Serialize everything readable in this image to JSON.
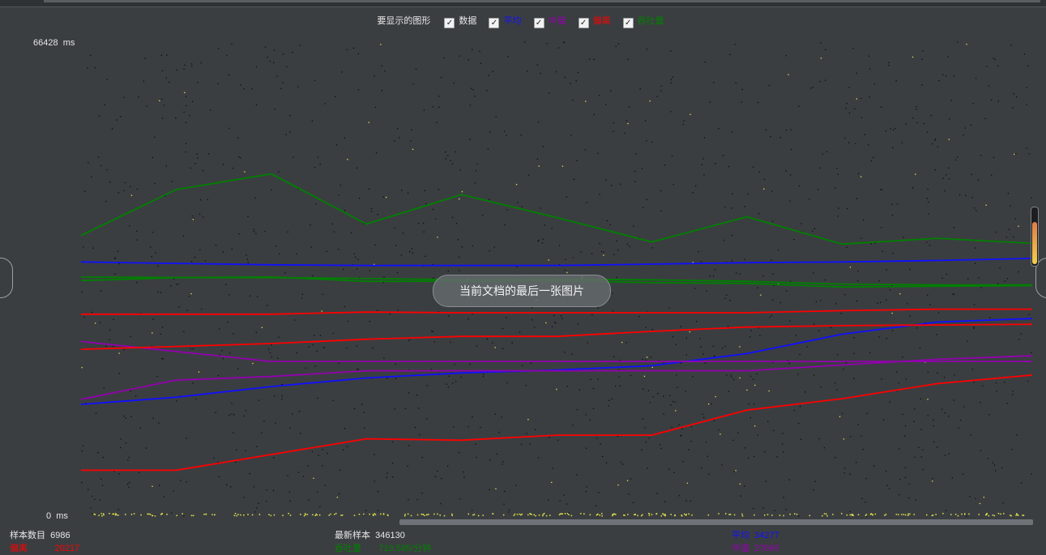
{
  "legend": {
    "title": "要显示的图形",
    "items": [
      {
        "label": "数据",
        "color": "#e6e6e6",
        "checked": true
      },
      {
        "label": "平均",
        "color": "#1010ff",
        "checked": true
      },
      {
        "label": "中值",
        "color": "#9400b0",
        "checked": true
      },
      {
        "label": "偏离",
        "color": "#ff0000",
        "checked": true
      },
      {
        "label": "吞吐量",
        "color": "#008000",
        "checked": true
      }
    ]
  },
  "axis": {
    "y_max_value": "66428",
    "y_min_value": "0",
    "unit": "ms"
  },
  "toast": "当前文档的最后一张图片",
  "stats": {
    "samples_label": "样本数目",
    "samples_value": "6986",
    "deviation_label": "偏离",
    "deviation_value": "20217",
    "latest_label": "最新样本",
    "latest_value": "346130",
    "throughput_label": "吞吐量",
    "throughput_value": "719,585/分钟",
    "average_label": "平均",
    "average_value": "34277",
    "median_label": "中值",
    "median_value": "27665"
  },
  "chart_data": {
    "type": "line",
    "title": "",
    "xlabel": "",
    "ylabel": "ms",
    "ylim": [
      0,
      66428
    ],
    "x": [
      0,
      10,
      20,
      30,
      40,
      50,
      60,
      70,
      80,
      90,
      100
    ],
    "series": [
      {
        "name": "平均",
        "color": "#1010ff",
        "values": [
          15600,
          16600,
          18100,
          19300,
          20000,
          20400,
          21000,
          22700,
          25400,
          27100,
          27600
        ]
      },
      {
        "name": "平均",
        "color": "#1010ff",
        "values": [
          35500,
          35300,
          35100,
          35000,
          35000,
          35000,
          35200,
          35400,
          35500,
          35700,
          36000
        ]
      },
      {
        "name": "中值",
        "color": "#9400b0",
        "values": [
          16300,
          19000,
          19500,
          20300,
          20300,
          20300,
          20300,
          20300,
          21100,
          21900,
          22400
        ]
      },
      {
        "name": "中值",
        "color": "#9400b0",
        "values": [
          24400,
          23000,
          21600,
          21600,
          21600,
          21600,
          21600,
          21600,
          21600,
          21600,
          21600
        ]
      },
      {
        "name": "偏离",
        "color": "#ff0000",
        "values": [
          6400,
          6400,
          8600,
          10800,
          10600,
          11300,
          11300,
          14800,
          16400,
          18500,
          19700
        ]
      },
      {
        "name": "偏离",
        "color": "#ff0000",
        "values": [
          23300,
          23700,
          24100,
          24700,
          25100,
          25100,
          25800,
          26400,
          26600,
          26700,
          26800
        ]
      },
      {
        "name": "偏离",
        "color": "#ff0000",
        "values": [
          28200,
          28200,
          28200,
          28500,
          28400,
          28400,
          28400,
          28400,
          28700,
          28900,
          28900
        ]
      },
      {
        "name": "吞吐量",
        "color": "#008000",
        "values": [
          39200,
          45600,
          47800,
          40800,
          44900,
          41700,
          38300,
          41800,
          38000,
          38800,
          38100
        ]
      },
      {
        "name": "吞吐量",
        "color": "#008000",
        "values": [
          32900,
          33300,
          33300,
          33200,
          33000,
          33100,
          33000,
          32800,
          32400,
          32300,
          32300
        ]
      },
      {
        "name": "吞吐量",
        "color": "#008000",
        "values": [
          33400,
          33300,
          33400,
          32800,
          32800,
          32900,
          32600,
          32500,
          32000,
          32100,
          32200
        ]
      }
    ],
    "grid": false
  }
}
